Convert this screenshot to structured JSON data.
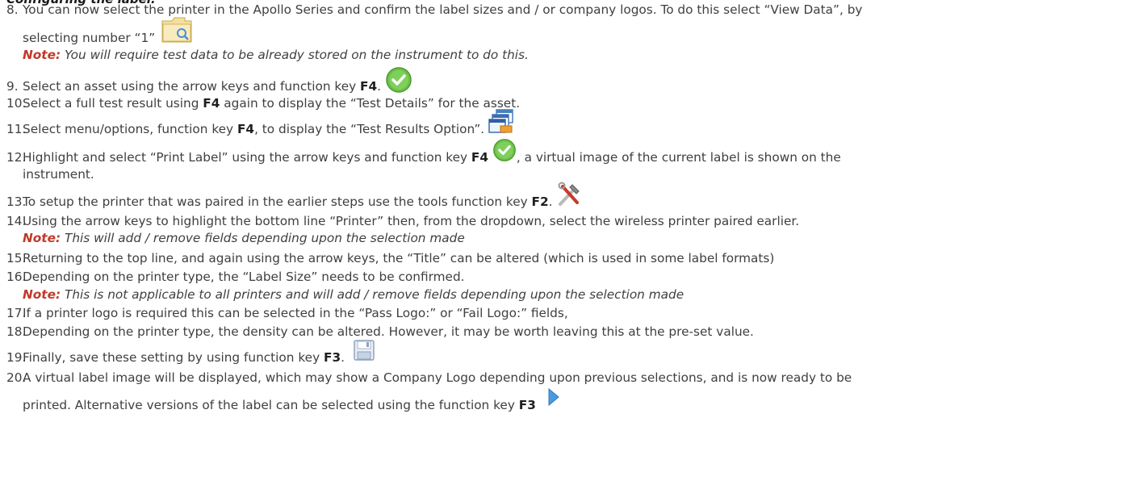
{
  "heading": "Configuring the label:",
  "steps": [
    {
      "num": "8.",
      "text": "You can now select the printer in the Apollo Series and confirm the label sizes and / or company logos. To do this select “View Data”, by",
      "cont": "selecting number “1”",
      "icon": "folder-icon"
    },
    {
      "num": "9.",
      "text_before": "Select an asset using the arrow keys and function key ",
      "key": "F4",
      "text_after": ".",
      "icon": "green-check-icon"
    },
    {
      "num": "10.",
      "text_before": "Select a full test result using ",
      "key": "F4",
      "text_after": " again to display the “Test Details” for the asset."
    },
    {
      "num": "11.",
      "text_before": "Select menu/options, function key ",
      "key": "F4",
      "text_after": ", to display the “Test Results Option”.",
      "icon": "windows-options-icon"
    },
    {
      "num": "12.",
      "text_before": "Highlight and select “Print Label” using the arrow keys and function key ",
      "key": "F4",
      "text_after": ", a virtual image of the current label is shown on the",
      "cont": "instrument.",
      "icon": "green-check-icon"
    },
    {
      "num": "13.",
      "text_before": "To setup the printer that was paired in the earlier steps use the tools function key ",
      "key": "F2",
      "text_after": ".",
      "icon": "tools-icon"
    },
    {
      "num": "14.",
      "text": "Using the arrow keys to highlight the bottom line “Printer” then, from the dropdown, select the wireless printer paired earlier."
    },
    {
      "num": "15.",
      "text": "Returning to the top line, and again using the arrow keys, the “Title” can be altered (which is used in some label formats)"
    },
    {
      "num": "16.",
      "text": "Depending on the printer type, the “Label Size” needs to be confirmed."
    },
    {
      "num": "17.",
      "text": "If a printer logo is required this can be selected in the “Pass Logo:” or “Fail Logo:” fields,"
    },
    {
      "num": "18.",
      "text": "Depending on the printer type, the density can be altered. However, it may be worth leaving this at the pre-set value."
    },
    {
      "num": "19.",
      "text_before": "Finally, save these setting by using function key ",
      "key": "F3",
      "text_after": ".",
      "icon": "save-disk-icon"
    },
    {
      "num": "20.",
      "text": "A virtual label image will be displayed, which may show a Company Logo depending upon previous selections, and is now ready to be",
      "cont_before": "printed. Alternative versions of the label can be selected using the function key ",
      "key": "F3",
      "icon": "next-arrow-icon"
    }
  ],
  "notes": [
    {
      "label": "Note:",
      "text": "You will require test data to be already stored on the instrument to do this."
    },
    {
      "label": "Note:",
      "text": "This will add / remove fields depending upon the selection made"
    },
    {
      "label": "Note:",
      "text": "This is not applicable to all printers and will add / remove fields depending upon the selection made"
    }
  ],
  "colors": {
    "note_label": "#c0392b",
    "check_green": "#6cc04a",
    "body_text": "#3f3f3f"
  }
}
